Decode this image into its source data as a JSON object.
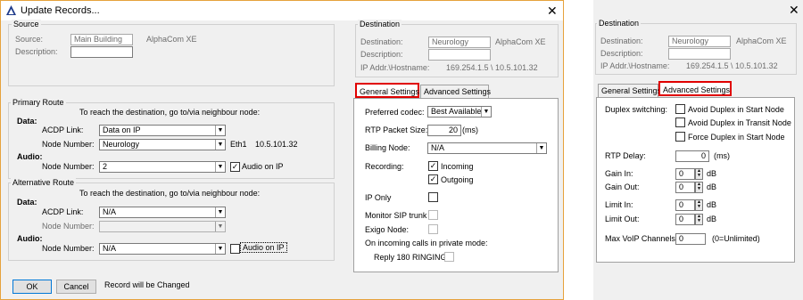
{
  "window": {
    "title": "Update Records...",
    "close_glyph": "✕"
  },
  "source": {
    "group_label": "Source",
    "source_label": "Source:",
    "source_value": "Main Building",
    "source_system": "AlphaCom XE",
    "description_label": "Description:",
    "description_value": ""
  },
  "destination": {
    "group_label": "Destination",
    "destination_label": "Destination:",
    "destination_value": "Neurology",
    "destination_system": "AlphaCom XE",
    "description_label": "Description:",
    "description_value": "",
    "ip_label": "IP Addr.\\Hostname:",
    "ip_value": "169.254.1.5 \\ 10.5.101.32"
  },
  "primary_route": {
    "group_label": "Primary Route",
    "instruction": "To reach the destination, go to/via neighbour node:",
    "data_label": "Data:",
    "acdp_label": "ACDP Link:",
    "acdp_value": "Data on IP",
    "node_label": "Node Number:",
    "node_value": "Neurology",
    "eth_label": "Eth1",
    "eth_ip": "10.5.101.32",
    "audio_label": "Audio:",
    "audio_node_label": "Node Number:",
    "audio_node_value": "2",
    "audio_on_ip_label": "Audio on IP",
    "audio_on_ip_checked": true
  },
  "alt_route": {
    "group_label": "Alternative Route",
    "instruction": "To reach the destination, go to/via neighbour node:",
    "data_label": "Data:",
    "acdp_label": "ACDP Link:",
    "acdp_value": "N/A",
    "node_label": "Node Number:",
    "node_value": "",
    "audio_label": "Audio:",
    "audio_node_label": "Node Number:",
    "audio_node_value": "N/A",
    "audio_on_ip_label": "Audio on IP",
    "audio_on_ip_checked": false
  },
  "tabs": {
    "general": "General Settings",
    "advanced": "Advanced Settings"
  },
  "general": {
    "codec_label": "Preferred codec:",
    "codec_value": "Best Available",
    "rtp_label": "RTP Packet Size:",
    "rtp_value": "20",
    "rtp_unit": "(ms)",
    "billing_label": "Billing Node:",
    "billing_value": "N/A",
    "recording_label": "Recording:",
    "incoming_label": "Incoming",
    "incoming_checked": true,
    "outgoing_label": "Outgoing",
    "outgoing_checked": true,
    "ip_only_label": "IP Only",
    "monitor_sip_label": "Monitor SIP trunk",
    "exigo_label": "Exigo Node:",
    "incoming_private_label": "On incoming calls in private mode:",
    "reply_label": "Reply 180 RINGING"
  },
  "footer": {
    "ok_label": "OK",
    "cancel_label": "Cancel",
    "status": "Record will be Changed"
  },
  "advanced": {
    "duplex_label": "Duplex switching:",
    "avoid_start_label": "Avoid Duplex in Start Node",
    "avoid_transit_label": "Avoid Duplex in Transit Node",
    "force_start_label": "Force Duplex in Start Node",
    "rtp_delay_label": "RTP Delay:",
    "rtp_delay_value": "0",
    "rtp_delay_unit": "(ms)",
    "gain_in_label": "Gain In:",
    "gain_in_value": "0",
    "gain_in_unit": "dB",
    "gain_out_label": "Gain Out:",
    "gain_out_value": "0",
    "gain_out_unit": "dB",
    "limit_in_label": "Limit In:",
    "limit_in_value": "0",
    "limit_in_unit": "dB",
    "limit_out_label": "Limit Out:",
    "limit_out_value": "0",
    "limit_out_unit": "dB",
    "max_voip_label": "Max VoIP Channels:",
    "max_voip_value": "0",
    "max_voip_note": "(0=Unlimited)"
  },
  "glyphs": {
    "dropdown": "▼",
    "check": "✓",
    "spin_up": "▲",
    "spin_down": "▼"
  }
}
